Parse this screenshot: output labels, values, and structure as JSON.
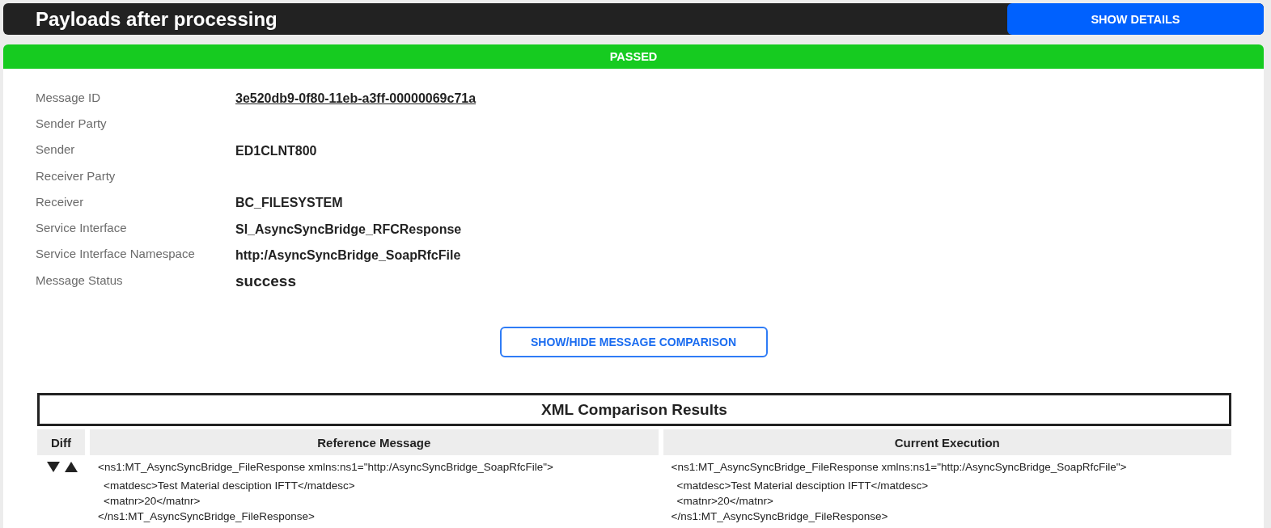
{
  "header": {
    "title": "Payloads after processing",
    "button": "SHOW DETAILS"
  },
  "status": {
    "label": "PASSED"
  },
  "details": [
    {
      "label": "Message ID",
      "value": "3e520db9-0f80-11eb-a3ff-00000069c71a",
      "kind": "link"
    },
    {
      "label": "Sender Party"
    },
    {
      "label": "Sender",
      "value": "ED1CLNT800",
      "kind": "text"
    },
    {
      "label": "Receiver Party"
    },
    {
      "label": "Receiver",
      "value": "BC_FILESYSTEM",
      "kind": "text"
    },
    {
      "label": "Service Interface",
      "value": "SI_AsyncSyncBridge_RFCResponse",
      "kind": "text"
    },
    {
      "label": "Service Interface Namespace",
      "value": "http:/AsyncSyncBridge_SoapRfcFile",
      "kind": "text"
    },
    {
      "label": "Message Status",
      "value": "success",
      "kind": "status"
    }
  ],
  "comparison_button": "SHOW/HIDE MESSAGE COMPARISON",
  "comparison": {
    "title": "XML Comparison Results",
    "columns": [
      "Diff",
      "Reference Message",
      "Current Execution"
    ],
    "rows": [
      {
        "reference": [
          {
            "text": "<ns1:MT_AsyncSyncBridge_FileResponse xmlns:ns1=\"http:/AsyncSyncBridge_SoapRfcFile\">",
            "children": [
              {
                "text": "<matdesc>Test Material desciption IFTT</matdesc>"
              },
              {
                "text": "<matnr>20</matnr>"
              }
            ]
          },
          {
            "text": "</ns1:MT_AsyncSyncBridge_FileResponse>"
          }
        ],
        "current": [
          {
            "text": "<ns1:MT_AsyncSyncBridge_FileResponse xmlns:ns1=\"http:/AsyncSyncBridge_SoapRfcFile\">",
            "children": [
              {
                "text": "<matdesc>Test Material desciption IFTT</matdesc>"
              },
              {
                "text": "<matnr>20</matnr>"
              }
            ]
          },
          {
            "text": "</ns1:MT_AsyncSyncBridge_FileResponse>"
          }
        ]
      }
    ]
  }
}
